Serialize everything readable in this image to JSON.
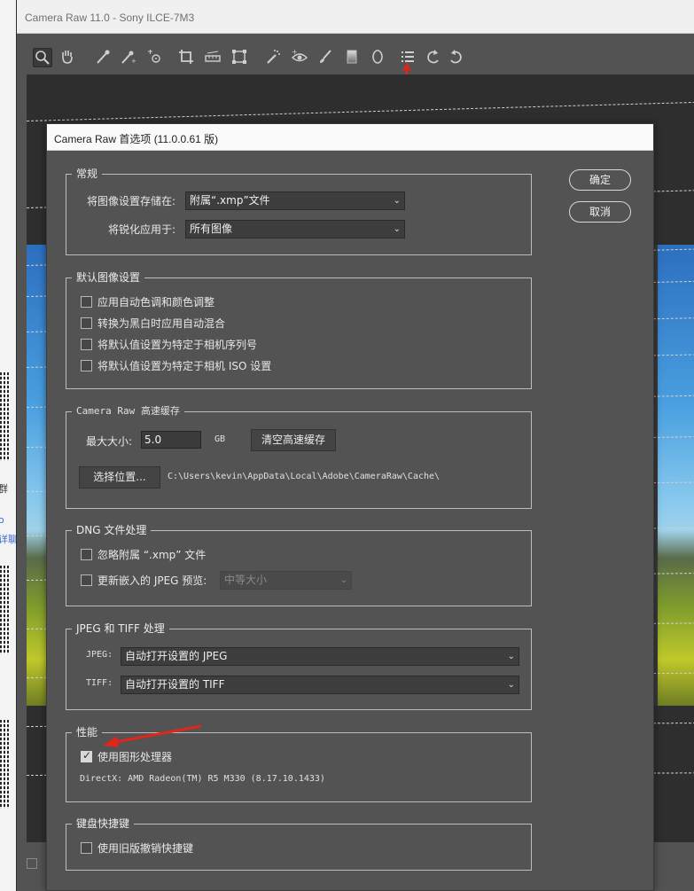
{
  "app": {
    "window_title": "Camera Raw 11.0  -  Sony ILCE-7M3"
  },
  "background_side": {
    "text_1": "群",
    "text_2": "o",
    "text_3": "详聊"
  },
  "toolbar": {
    "tools": [
      {
        "name": "zoom-tool-icon",
        "glyph": "🔍︎"
      },
      {
        "name": "hand-tool-icon",
        "glyph": "✋︎"
      },
      {
        "name": "white-balance-tool-icon",
        "glyph": "⁄"
      },
      {
        "name": "color-sampler-tool-icon",
        "glyph": "⁂"
      },
      {
        "name": "targeted-adjustment-tool-icon",
        "glyph": "⊙"
      },
      {
        "name": "crop-tool-icon",
        "glyph": "⌗"
      },
      {
        "name": "straighten-tool-icon",
        "glyph": "⊟"
      },
      {
        "name": "transform-tool-icon",
        "glyph": "⊡"
      },
      {
        "name": "spot-removal-tool-icon",
        "glyph": "⁄"
      },
      {
        "name": "red-eye-tool-icon",
        "glyph": "◉"
      },
      {
        "name": "adjustment-brush-icon",
        "glyph": "⁄"
      },
      {
        "name": "graduated-filter-icon",
        "glyph": "▮"
      },
      {
        "name": "radial-filter-icon",
        "glyph": "○"
      },
      {
        "name": "preferences-icon",
        "glyph": "☰"
      },
      {
        "name": "rotate-left-icon",
        "glyph": "↺"
      },
      {
        "name": "rotate-right-icon",
        "glyph": "↻"
      }
    ]
  },
  "dialog": {
    "title": "Camera Raw 首选项 (11.0.0.61 版)",
    "ok_label": "确定",
    "cancel_label": "取消",
    "general": {
      "legend": "常规",
      "save_settings_label": "将图像设置存储在:",
      "save_settings_value": "附属“.xmp”文件",
      "sharpen_label": "将锐化应用于:",
      "sharpen_value": "所有图像"
    },
    "default_image": {
      "legend": "默认图像设置",
      "opt1": "应用自动色调和颜色调整",
      "opt2": "转换为黑白时应用自动混合",
      "opt3": "将默认值设置为特定于相机序列号",
      "opt4": "将默认值设置为特定于相机 ISO 设置"
    },
    "cache": {
      "legend": "Camera Raw 高速缓存",
      "max_size_label": "最大大小:",
      "max_size_value": "5.0",
      "unit": "GB",
      "purge_label": "清空高速缓存",
      "select_location_label": "选择位置...",
      "path": "C:\\Users\\kevin\\AppData\\Local\\Adobe\\CameraRaw\\Cache\\"
    },
    "dng": {
      "legend": "DNG 文件处理",
      "ignore_xmp": "忽略附属 “.xmp” 文件",
      "update_preview": "更新嵌入的 JPEG 预览:",
      "preview_size": "中等大小"
    },
    "jpeg_tiff": {
      "legend": "JPEG 和 TIFF 处理",
      "jpeg_label": "JPEG:",
      "jpeg_value": "自动打开设置的 JPEG",
      "tiff_label": "TIFF:",
      "tiff_value": "自动打开设置的 TIFF"
    },
    "performance": {
      "legend": "性能",
      "use_gpu": "使用图形处理器",
      "gpu_checked": true,
      "directx": "DirectX: AMD Radeon(TM) R5 M330 (8.17.10.1433)"
    },
    "shortcuts": {
      "legend": "键盘快捷键",
      "legacy_undo": "使用旧版撤销快捷键"
    }
  }
}
